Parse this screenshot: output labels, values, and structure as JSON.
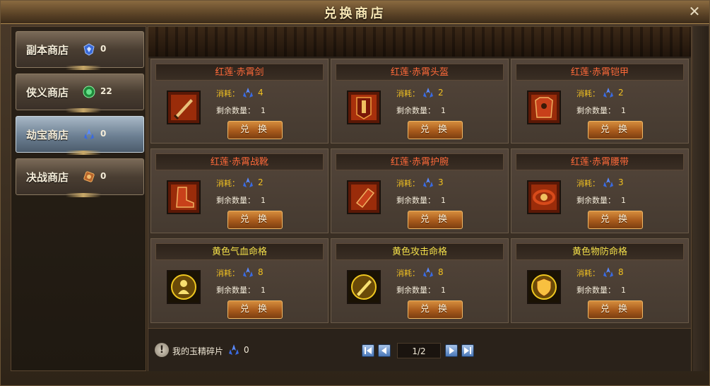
{
  "window": {
    "title": "兑换商店"
  },
  "sidebar": {
    "items": [
      {
        "label": "副本商店",
        "count": "0",
        "icon": "blue-crest-icon",
        "active": false
      },
      {
        "label": "侠义商店",
        "count": "22",
        "icon": "green-orb-icon",
        "active": false
      },
      {
        "label": "劫宝商店",
        "count": "0",
        "icon": "jade-shard-icon",
        "active": true
      },
      {
        "label": "决战商店",
        "count": "0",
        "icon": "bronze-medal-icon",
        "active": false
      }
    ]
  },
  "shop": {
    "cost_label": "消耗：",
    "remain_label": "剩余数量：",
    "button_label": "兑 换",
    "items": [
      {
        "name": "红莲·赤霄剑",
        "cost": "4",
        "remain": "1",
        "icon": "sword-icon",
        "name_color": "#ff6a3a"
      },
      {
        "name": "红莲·赤霄头盔",
        "cost": "2",
        "remain": "1",
        "icon": "helmet-icon",
        "name_color": "#ff6a3a"
      },
      {
        "name": "红莲·赤霄铠甲",
        "cost": "2",
        "remain": "1",
        "icon": "armor-icon",
        "name_color": "#ff6a3a"
      },
      {
        "name": "红莲·赤霄战靴",
        "cost": "2",
        "remain": "1",
        "icon": "boots-icon",
        "name_color": "#ff6a3a"
      },
      {
        "name": "红莲·赤霄护腕",
        "cost": "3",
        "remain": "1",
        "icon": "bracer-icon",
        "name_color": "#ff6a3a"
      },
      {
        "name": "红莲·赤霄腰带",
        "cost": "3",
        "remain": "1",
        "icon": "belt-icon",
        "name_color": "#ff6a3a"
      },
      {
        "name": "黄色气血命格",
        "cost": "8",
        "remain": "1",
        "icon": "vitality-rune-icon",
        "name_color": "#f4e04a"
      },
      {
        "name": "黄色攻击命格",
        "cost": "8",
        "remain": "1",
        "icon": "attack-rune-icon",
        "name_color": "#f4e04a"
      },
      {
        "name": "黄色物防命格",
        "cost": "8",
        "remain": "1",
        "icon": "defense-rune-icon",
        "name_color": "#f4e04a"
      }
    ]
  },
  "footer": {
    "fragment_label": "我的玉精碎片",
    "fragment_count": "0",
    "page": "1/2"
  }
}
